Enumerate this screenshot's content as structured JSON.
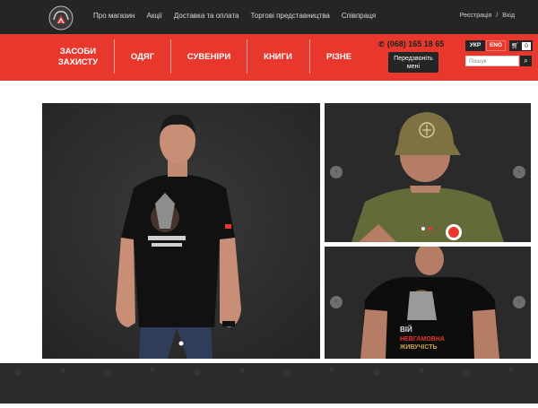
{
  "topnav": {
    "items": [
      "Про магазин",
      "Акції",
      "Доставка та оплата",
      "Торгові представництва",
      "Співпраця"
    ],
    "auth": {
      "register": "Реєстрація",
      "divider": "/",
      "login": "Вхід"
    }
  },
  "categories": [
    "ЗАСОБИ\nЗАХИСТУ",
    "ОДЯГ",
    "СУВЕНІРИ",
    "КНИГИ",
    "РІЗНЕ"
  ],
  "contact": {
    "phone": "(068) 165 18 65",
    "callback": "Передзвоніть мені"
  },
  "lang": {
    "ukr": "УКР",
    "eng": "ENG"
  },
  "cart": {
    "count": "0"
  },
  "search": {
    "placeholder": "Пошук"
  },
  "slider": {
    "prev": "‹",
    "next": "›"
  },
  "shirt_print": {
    "line1": "ВІЙ",
    "line2": "НЕВГАМОВНА",
    "line3": "ЖИВУЧІСТЬ"
  },
  "colors": {
    "accent": "#e8382d",
    "dark": "#252525"
  }
}
